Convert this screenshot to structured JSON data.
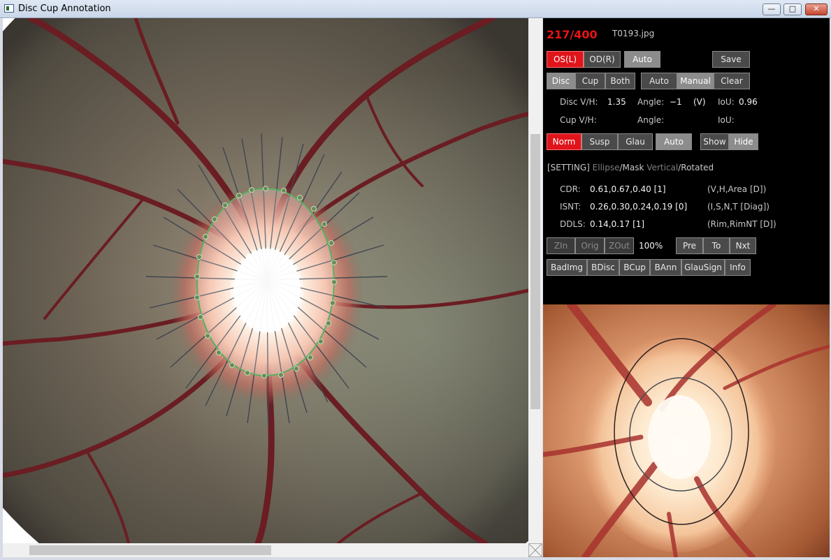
{
  "window": {
    "title": "Disc Cup Annotation",
    "minimize": "—",
    "maximize": "□",
    "close": "✕"
  },
  "status": {
    "counter": "217/400",
    "filename": "T0193.jpg"
  },
  "eye_buttons": {
    "os": "OS(L)",
    "od": "OD(R)",
    "auto": "Auto",
    "save": "Save"
  },
  "target_buttons": {
    "disc": "Disc",
    "cup": "Cup",
    "both": "Both",
    "auto": "Auto",
    "manual": "Manual",
    "clear": "Clear"
  },
  "measure": {
    "disc_label": "Disc  V/H:",
    "disc_vh": "1.35",
    "disc_angle_label": "Angle:",
    "disc_angle": "−1",
    "disc_v": "(V)",
    "disc_iou_label": "IoU:",
    "disc_iou": "0.96",
    "cup_label": "Cup  V/H:",
    "cup_angle_label": "Angle:",
    "cup_iou_label": "IoU:"
  },
  "diagnosis_buttons": {
    "norm": "Norm",
    "susp": "Susp",
    "glau": "Glau",
    "auto": "Auto",
    "show": "Show",
    "hide": "Hide"
  },
  "setting": {
    "label": "[SETTING]",
    "ellipse": "Ellipse",
    "sep1": "/",
    "mask": "Mask",
    "vertical": "Vertical",
    "sep2": "/",
    "rotated": "Rotated"
  },
  "metrics": {
    "cdr_label": "CDR:",
    "cdr_value": "0.61,0.67,0.40 [1]",
    "cdr_desc": "(V,H,Area [D])",
    "isnt_label": "ISNT:",
    "isnt_value": "0.26,0.30,0.24,0.19 [0]",
    "isnt_desc": "(I,S,N,T [Diag])",
    "ddls_label": "DDLS:",
    "ddls_value": "0.14,0.17 [1]",
    "ddls_desc": "(Rim,RimNT [D])"
  },
  "zoom": {
    "zin": "ZIn",
    "orig": "Orig",
    "zout": "ZOut",
    "level": "100%",
    "pre": "Pre",
    "to": "To",
    "nxt": "Nxt"
  },
  "flags": {
    "badimg": "BadImg",
    "bdisc": "BDisc",
    "bcup": "BCup",
    "bann": "BAnn",
    "glausign": "GlauSign",
    "info": "Info"
  },
  "colors": {
    "accent_red": "#e0141b",
    "panel_bg": "#000000",
    "contour_green": "#58b060"
  }
}
